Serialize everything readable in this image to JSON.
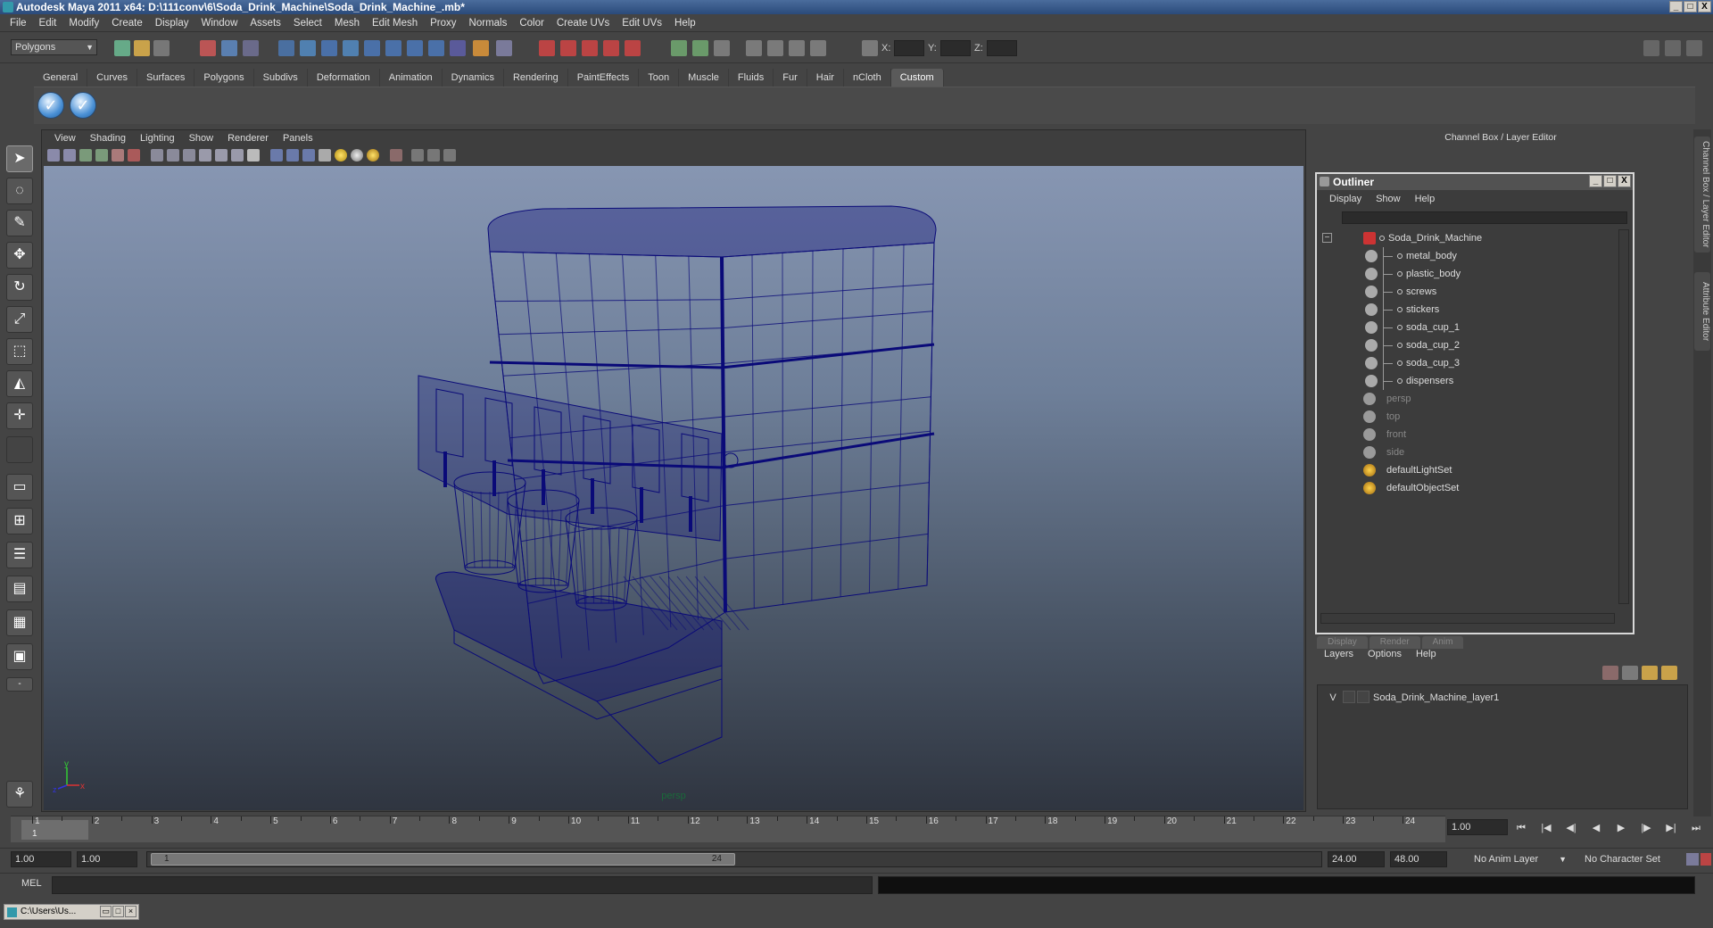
{
  "window": {
    "title": "Autodesk Maya 2011 x64: D:\\111conv\\6\\Soda_Drink_Machine\\Soda_Drink_Machine_.mb*",
    "controls": [
      "_",
      "□",
      "X"
    ]
  },
  "menubar": [
    "File",
    "Edit",
    "Modify",
    "Create",
    "Display",
    "Window",
    "Assets",
    "Select",
    "Mesh",
    "Edit Mesh",
    "Proxy",
    "Normals",
    "Color",
    "Create UVs",
    "Edit UVs",
    "Help"
  ],
  "statusline": {
    "mode": "Polygons",
    "x_label": "X:",
    "y_label": "Y:",
    "z_label": "Z:"
  },
  "shelf": {
    "tabs": [
      "General",
      "Curves",
      "Surfaces",
      "Polygons",
      "Subdivs",
      "Deformation",
      "Animation",
      "Dynamics",
      "Rendering",
      "PaintEffects",
      "Toon",
      "Muscle",
      "Fluids",
      "Fur",
      "Hair",
      "nCloth",
      "Custom"
    ],
    "active_tab": "Custom"
  },
  "viewport": {
    "menu": [
      "View",
      "Shading",
      "Lighting",
      "Show",
      "Renderer",
      "Panels"
    ],
    "camera_label": "persp",
    "axis_y": "y",
    "axis_x": "x",
    "axis_z": "z",
    "wire_color": "#0a0a78"
  },
  "channel_box": {
    "title": "Channel Box / Layer Editor"
  },
  "outliner": {
    "title": "Outliner",
    "menu": [
      "Display",
      "Show",
      "Help"
    ],
    "items": [
      {
        "label": "Soda_Drink_Machine",
        "level": 0,
        "type": "group",
        "dim": false,
        "expanded": true
      },
      {
        "label": "metal_body",
        "level": 1,
        "type": "mesh",
        "dim": false
      },
      {
        "label": "plastic_body",
        "level": 1,
        "type": "mesh",
        "dim": false
      },
      {
        "label": "screws",
        "level": 1,
        "type": "mesh",
        "dim": false
      },
      {
        "label": "stickers",
        "level": 1,
        "type": "mesh",
        "dim": false
      },
      {
        "label": "soda_cup_1",
        "level": 1,
        "type": "mesh",
        "dim": false
      },
      {
        "label": "soda_cup_2",
        "level": 1,
        "type": "mesh",
        "dim": false
      },
      {
        "label": "soda_cup_3",
        "level": 1,
        "type": "mesh",
        "dim": false
      },
      {
        "label": "dispensers",
        "level": 1,
        "type": "mesh",
        "dim": false
      },
      {
        "label": "persp",
        "level": 0,
        "type": "camera",
        "dim": true
      },
      {
        "label": "top",
        "level": 0,
        "type": "camera",
        "dim": true
      },
      {
        "label": "front",
        "level": 0,
        "type": "camera",
        "dim": true
      },
      {
        "label": "side",
        "level": 0,
        "type": "camera",
        "dim": true
      },
      {
        "label": "defaultLightSet",
        "level": 0,
        "type": "set",
        "dim": false
      },
      {
        "label": "defaultObjectSet",
        "level": 0,
        "type": "set",
        "dim": false
      }
    ]
  },
  "layer_editor": {
    "tabs": [
      "Display",
      "Render",
      "Anim"
    ],
    "menu": [
      "Layers",
      "Options",
      "Help"
    ],
    "layers": [
      {
        "visible": "V",
        "name": "Soda_Drink_Machine_layer1"
      }
    ]
  },
  "vertical_tabs": [
    "Channel Box / Layer Editor",
    "Attribute Editor"
  ],
  "timeline": {
    "ticks": [
      "1",
      "2",
      "3",
      "4",
      "5",
      "6",
      "7",
      "8",
      "9",
      "10",
      "11",
      "12",
      "13",
      "14",
      "15",
      "16",
      "17",
      "18",
      "19",
      "20",
      "21",
      "22",
      "23",
      "24"
    ],
    "current_frame_marker": "1",
    "current_time": "1.00"
  },
  "range": {
    "start": "1.00",
    "playback_start": "1.00",
    "thumb_start": "1",
    "thumb_end": "24",
    "playback_end": "24.00",
    "end": "48.00",
    "anim_layer": "No Anim Layer",
    "character_set": "No Character Set"
  },
  "command_line": {
    "label": "MEL"
  },
  "taskbar": {
    "item": "C:\\Users\\Us..."
  }
}
